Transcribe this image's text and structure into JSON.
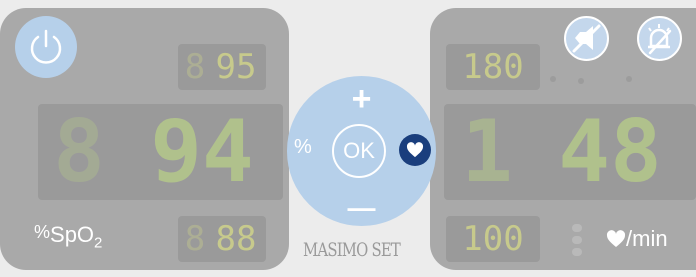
{
  "left": {
    "main_value": "94",
    "main_prefix": "8",
    "upper_small": "95",
    "upper_prefix": "8",
    "lower_small": "88",
    "lower_prefix": "8",
    "unit_percent": "%",
    "unit_spo": "SpO",
    "unit_sub": "2"
  },
  "right": {
    "main_value": "48",
    "main_prefix": "1",
    "upper_small": "180",
    "lower_small": "100",
    "unit_label": "/min"
  },
  "center": {
    "plus": "+",
    "minus": "—",
    "ok": "OK",
    "percent": "%"
  },
  "logo": {
    "text": "MASIMO SET",
    "color": "#c0392b"
  },
  "colors": {
    "panel": "#a9a9a9",
    "digit": "#b5c88a",
    "center": "#b6d0ea",
    "heart_badge": "#1a3e7d"
  },
  "icons": [
    "power-icon",
    "alarm-silence-icon",
    "alarm-bell-icon",
    "heart-icon"
  ]
}
